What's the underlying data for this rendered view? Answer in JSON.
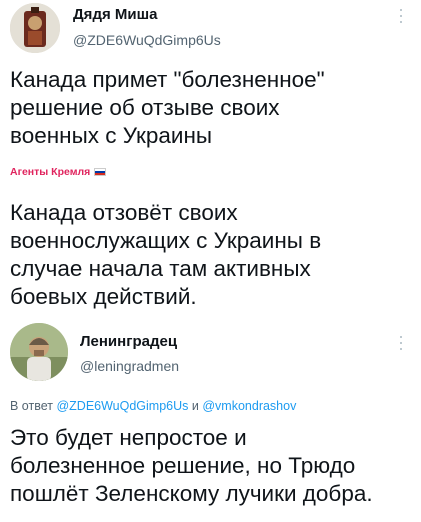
{
  "tweet1": {
    "display_name": "Дядя Миша",
    "handle": "@ZDE6WuQdGimp6Us",
    "lines": [
      "Канада примет \"болезненное\"",
      "решение об отзыве своих",
      "военных с Украины"
    ],
    "channel_label": "Агенты Кремля",
    "quote_lines": [
      "Канада отзовёт своих",
      "военнослужащих с Украины в",
      "случае начала там активных",
      "боевых действий."
    ]
  },
  "tweet2": {
    "display_name": "Ленинградец",
    "handle": "@leningradmen",
    "reply_prefix": "В ответ",
    "reply_mention_1": "@ZDE6WuQdGimp6Us",
    "reply_and": "и",
    "reply_mention_2": "@vmkondrashov",
    "lines": [
      "Это будет непростое и",
      "болезненное решение, но Трюдо",
      "пошлёт Зеленскому лучики добра."
    ]
  },
  "colors": {
    "text": "#0f1419",
    "secondary": "#536471",
    "mention": "#1d9bf0",
    "channel": "#e0245e"
  },
  "icons": [
    "more-icon",
    "flag-icon"
  ]
}
